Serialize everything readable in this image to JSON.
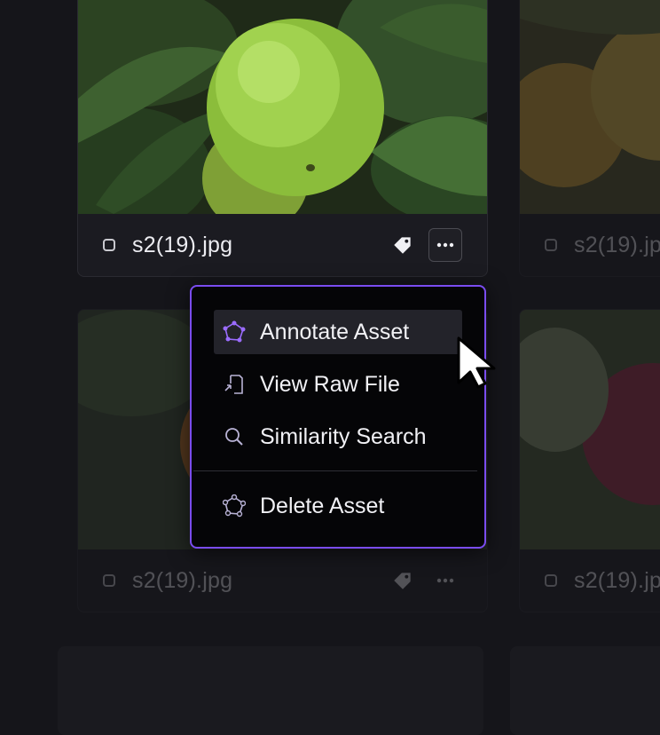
{
  "assets": [
    {
      "filename": "s2(19).jpg",
      "state": "active"
    },
    {
      "filename": "s2(19).jpg",
      "state": "dim"
    },
    {
      "filename": "s2(19).jpg",
      "state": "dim"
    },
    {
      "filename": "s2(19).jpg",
      "state": "dim"
    }
  ],
  "menu": {
    "items": [
      {
        "label": "Annotate Asset",
        "icon": "annotate-icon"
      },
      {
        "label": "View Raw File",
        "icon": "raw-file-icon"
      },
      {
        "label": "Similarity Search",
        "icon": "search-icon"
      },
      {
        "label": "Delete Asset",
        "icon": "delete-asset-icon"
      }
    ]
  },
  "colors": {
    "accent": "#7a4cf0",
    "background": "#15151a",
    "menu_background": "#050507"
  }
}
